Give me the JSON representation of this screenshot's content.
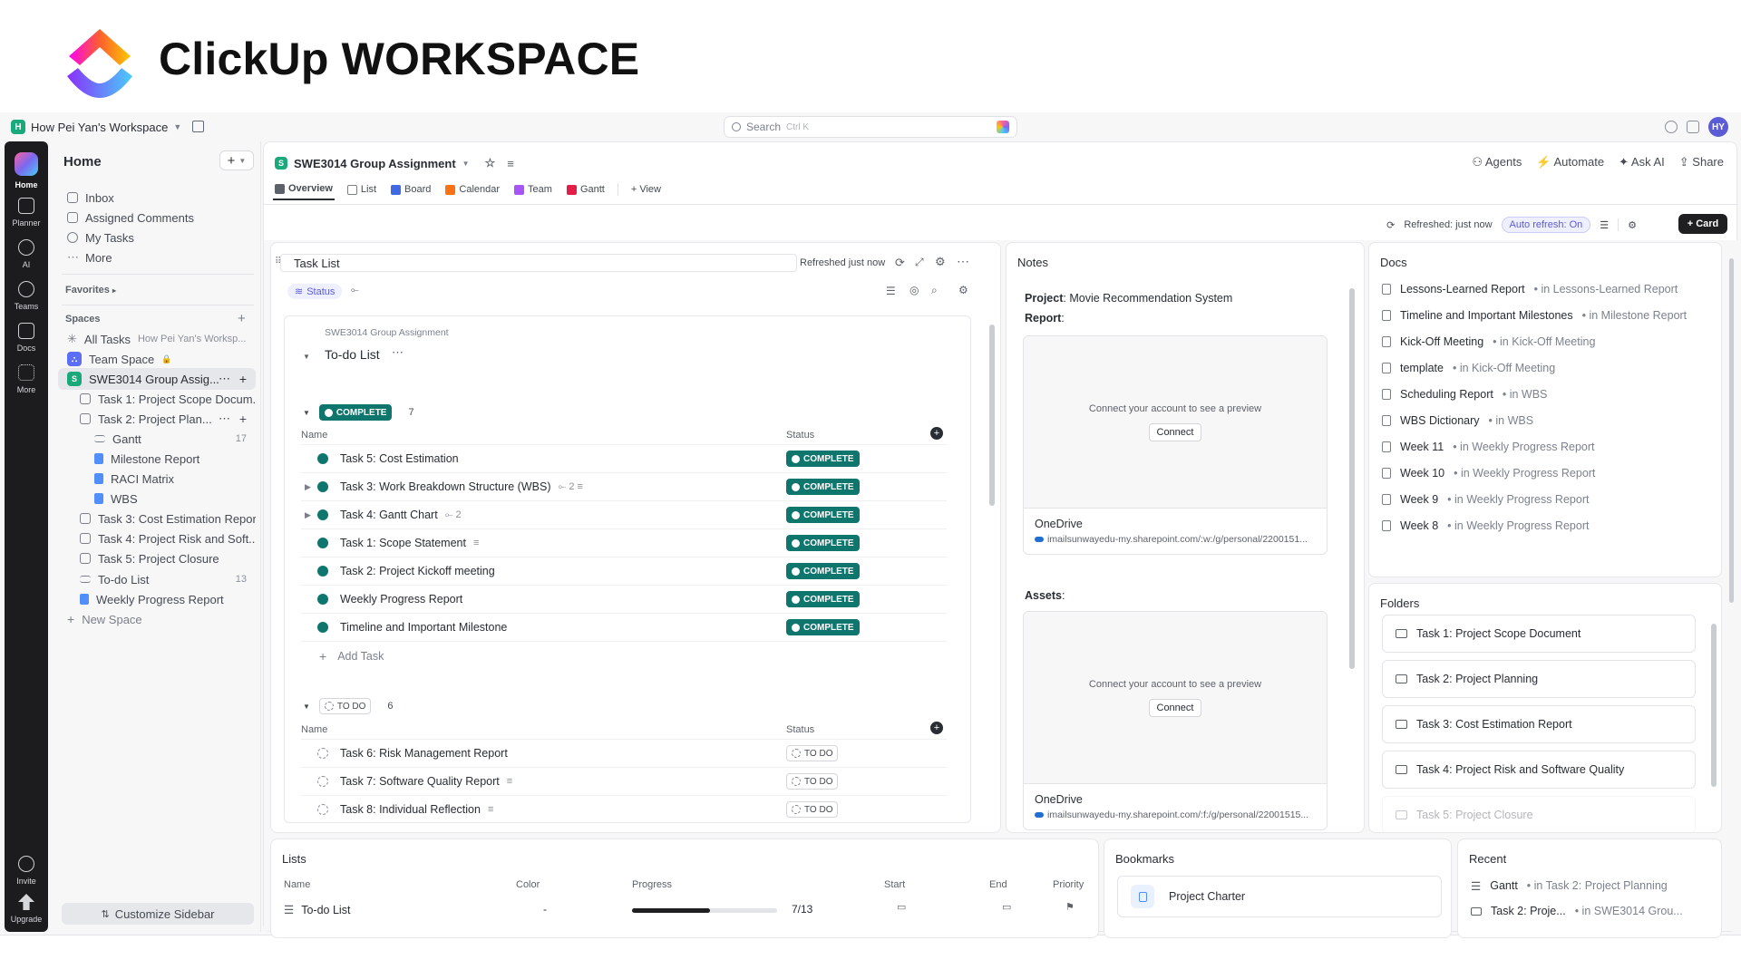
{
  "banner": {
    "title": "ClickUp WORKSPACE"
  },
  "topbar": {
    "workspace_badge": "H",
    "workspace_name": "How Pei Yan's Workspace",
    "search_placeholder": "Search",
    "search_shortcut": "Ctrl K",
    "avatar": "HY"
  },
  "rail": {
    "items": [
      {
        "label": "Home"
      },
      {
        "label": "Planner"
      },
      {
        "label": "AI"
      },
      {
        "label": "Teams"
      },
      {
        "label": "Docs"
      },
      {
        "label": "More"
      },
      {
        "label": "Invite"
      },
      {
        "label": "Upgrade"
      }
    ]
  },
  "sidebar": {
    "title": "Home",
    "nav": [
      "Inbox",
      "Assigned Comments",
      "My Tasks",
      "More"
    ],
    "favorites_label": "Favorites",
    "spaces_label": "Spaces",
    "all_tasks": "All Tasks",
    "all_tasks_sub": "How Pei Yan's Worksp...",
    "team_space": "Team Space",
    "space_badge": "S",
    "active_space": "SWE3014 Group Assig...",
    "tree": [
      {
        "label": "Task 1: Project Scope Docum...",
        "count": ""
      },
      {
        "label": "Task 2: Project Plan...",
        "count": ""
      },
      {
        "label": "Gantt",
        "count": "17"
      },
      {
        "label": "Milestone Report",
        "count": ""
      },
      {
        "label": "RACI Matrix",
        "count": ""
      },
      {
        "label": "WBS",
        "count": ""
      },
      {
        "label": "Task 3: Cost Estimation Report",
        "count": ""
      },
      {
        "label": "Task 4: Project Risk and Soft...",
        "count": ""
      },
      {
        "label": "Task 5: Project Closure",
        "count": ""
      },
      {
        "label": "To-do List",
        "count": "13"
      },
      {
        "label": "Weekly Progress Report",
        "count": ""
      }
    ],
    "new_space": "New Space",
    "customize": "Customize Sidebar"
  },
  "header": {
    "project_badge": "S",
    "project_title": "SWE3014 Group Assignment",
    "actions": [
      "Agents",
      "Automate",
      "Ask AI",
      "Share"
    ],
    "tabs": [
      "Overview",
      "List",
      "Board",
      "Calendar",
      "Team",
      "Gantt",
      "+ View"
    ],
    "refreshed": "Refreshed: just now",
    "auto_refresh": "Auto refresh: On",
    "card_button": "+ Card"
  },
  "task_list": {
    "title": "Task List",
    "refreshed": "Refreshed just now",
    "chip": "Status",
    "breadcrumb": "SWE3014 Group Assignment",
    "list_name": "To-do List",
    "groups": [
      {
        "status": "COMPLETE",
        "count": "7",
        "col_name": "Name",
        "col_status": "Status",
        "tasks": [
          {
            "name": "Task 5: Cost Estimation",
            "meta": "",
            "status": "COMPLETE"
          },
          {
            "name": "Task 3: Work Breakdown Structure (WBS)",
            "meta": "2",
            "status": "COMPLETE"
          },
          {
            "name": "Task 4: Gantt Chart",
            "meta": "2",
            "status": "COMPLETE"
          },
          {
            "name": "Task 1: Scope Statement",
            "meta": "",
            "status": "COMPLETE"
          },
          {
            "name": "Task 2: Project Kickoff meeting",
            "meta": "",
            "status": "COMPLETE"
          },
          {
            "name": "Weekly Progress Report",
            "meta": "",
            "status": "COMPLETE"
          },
          {
            "name": "Timeline and Important Milestone",
            "meta": "",
            "status": "COMPLETE"
          }
        ],
        "add_task": "Add Task"
      },
      {
        "status": "TO DO",
        "count": "6",
        "col_name": "Name",
        "col_status": "Status",
        "tasks": [
          {
            "name": "Task 6: Risk Management Report",
            "meta": "",
            "status": "TO DO"
          },
          {
            "name": "Task 7: Software Quality Report",
            "meta": "",
            "status": "TO DO"
          },
          {
            "name": "Task 8: Individual Reflection",
            "meta": "",
            "status": "TO DO"
          }
        ]
      }
    ]
  },
  "notes": {
    "title": "Notes",
    "project_label": "Project",
    "project_value": "Movie Recommendation System",
    "report_label": "Report",
    "assets_label": "Assets",
    "previews": [
      {
        "message": "Connect your account to see a preview",
        "button": "Connect",
        "title": "OneDrive",
        "url": "imailsunwayedu-my.sharepoint.com/:w:/g/personal/2200151..."
      },
      {
        "message": "Connect your account to see a preview",
        "button": "Connect",
        "title": "OneDrive",
        "url": "imailsunwayedu-my.sharepoint.com/:f:/g/personal/22001515..."
      }
    ]
  },
  "docs": {
    "title": "Docs",
    "items": [
      {
        "name": "Lessons-Learned Report",
        "loc": "in Lessons-Learned Report"
      },
      {
        "name": "Timeline and Important Milestones",
        "loc": "in Milestone Report"
      },
      {
        "name": "Kick-Off Meeting",
        "loc": "in Kick-Off Meeting"
      },
      {
        "name": "template",
        "loc": "in Kick-Off Meeting"
      },
      {
        "name": "Scheduling Report",
        "loc": "in WBS"
      },
      {
        "name": "WBS Dictionary",
        "loc": "in WBS"
      },
      {
        "name": "Week 11",
        "loc": "in Weekly Progress Report"
      },
      {
        "name": "Week 10",
        "loc": "in Weekly Progress Report"
      },
      {
        "name": "Week 9",
        "loc": "in Weekly Progress Report"
      },
      {
        "name": "Week 8",
        "loc": "in Weekly Progress Report"
      }
    ]
  },
  "folders": {
    "title": "Folders",
    "items": [
      "Task 1: Project Scope Document",
      "Task 2: Project Planning",
      "Task 3: Cost Estimation Report",
      "Task 4: Project Risk and Software Quality",
      "Task 5: Project Closure"
    ]
  },
  "lists": {
    "title": "Lists",
    "columns": [
      "Name",
      "Color",
      "Progress",
      "Start",
      "End",
      "Priority"
    ],
    "rows": [
      {
        "name": "To-do List",
        "color": "-",
        "progress": "7/13",
        "progress_fraction": 0.54
      }
    ]
  },
  "bookmarks": {
    "title": "Bookmarks",
    "items": [
      "Project Charter"
    ]
  },
  "recent": {
    "title": "Recent",
    "items": [
      {
        "name": "Gantt",
        "loc": "in Task 2: Project Planning"
      },
      {
        "name": "Task 2: Proje...",
        "loc": "in SWE3014 Grou..."
      }
    ]
  },
  "colors": {
    "complete": "#0f766e",
    "accent": "#5b5bd6",
    "rail": "#1c1c1f"
  }
}
